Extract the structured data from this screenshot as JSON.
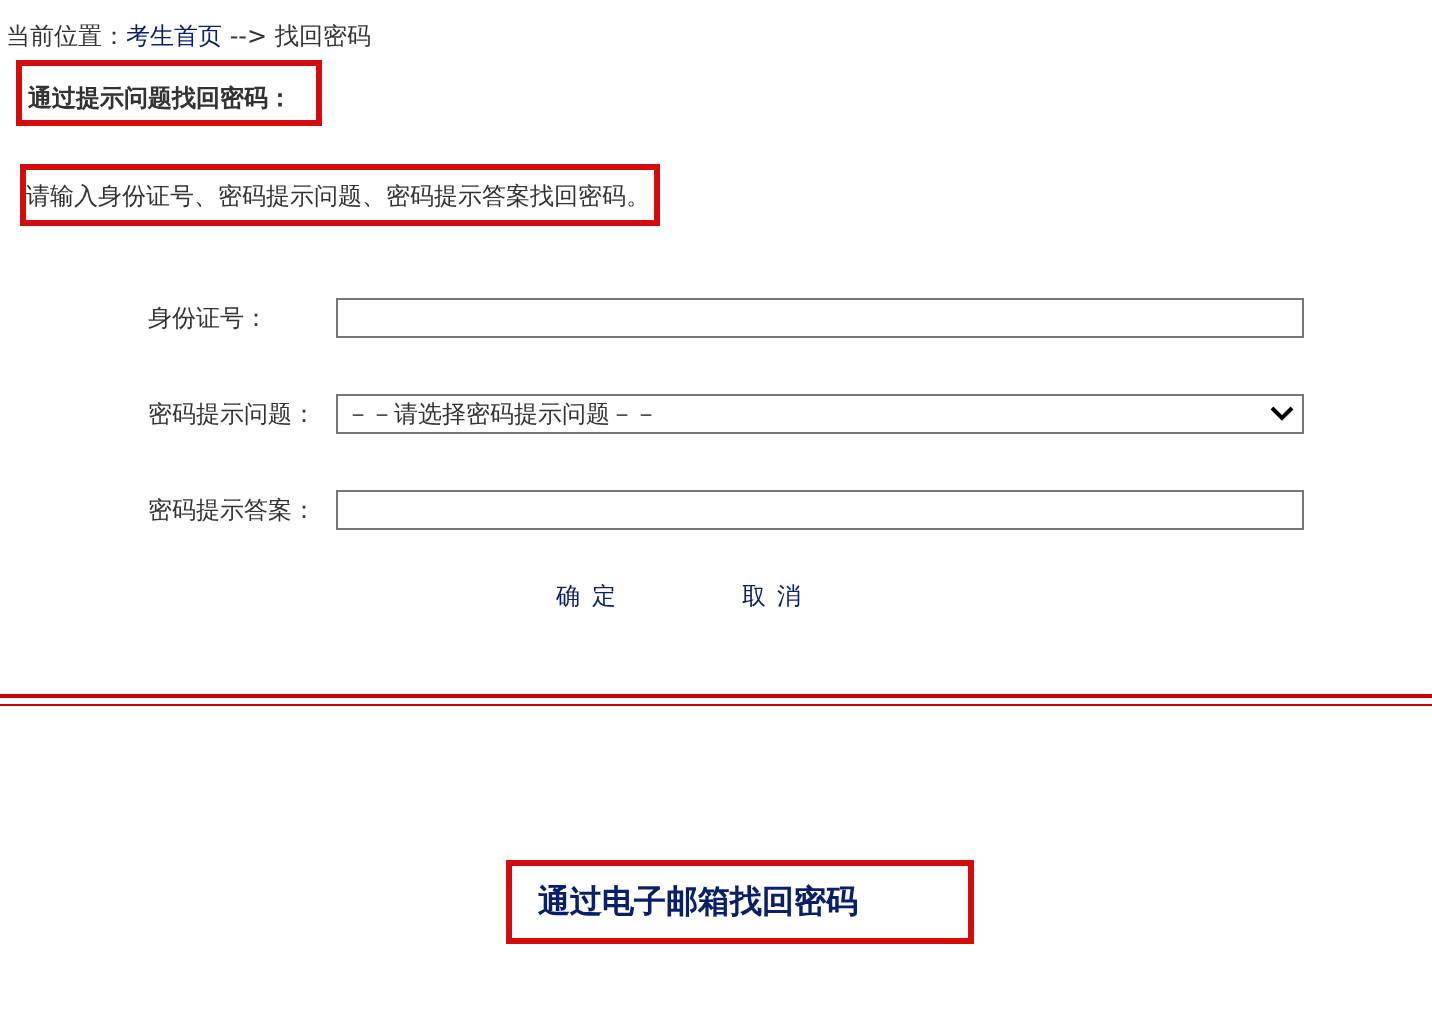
{
  "breadcrumb": {
    "label": "当前位置：",
    "link": "考生首页",
    "current": "--> 找回密码"
  },
  "section_title": "通过提示问题找回密码：",
  "instruction": "请输入身份证号、密码提示问题、密码提示答案找回密码。",
  "fields": [
    {
      "kind": "text",
      "label": "身份证号："
    },
    {
      "kind": "select",
      "label": "密码提示问题：",
      "value": "－－请选择密码提示问题－－"
    },
    {
      "kind": "text",
      "label": "密码提示答案："
    }
  ],
  "buttons": [
    "确 定",
    "取 消"
  ],
  "email_link": "通过电子邮箱找回密码"
}
